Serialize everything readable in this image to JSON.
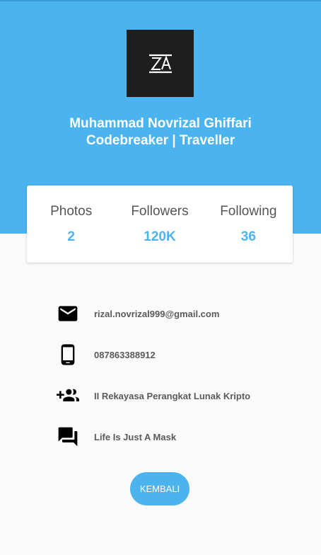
{
  "profile": {
    "name": "Muhammad Novrizal Ghiffari",
    "tagline": "Codebreaker | Traveller",
    "avatar_icon": "logo-za-icon"
  },
  "stats": [
    {
      "label": "Photos",
      "value": "2"
    },
    {
      "label": "Followers",
      "value": "120K"
    },
    {
      "label": "Following",
      "value": "36"
    }
  ],
  "info": [
    {
      "icon": "email-icon",
      "text": "rizal.novrizal999@gmail.com"
    },
    {
      "icon": "phone-icon",
      "text": "087863388912"
    },
    {
      "icon": "group-add-icon",
      "text": "II Rekayasa Perangkat Lunak Kripto"
    },
    {
      "icon": "chat-icon",
      "text": "Life Is Just A Mask"
    }
  ],
  "back_button": {
    "label": "KEMBALI"
  },
  "colors": {
    "accent": "#4bb3ee",
    "background": "#fafafa",
    "card": "#ffffff",
    "avatar_bg": "#1e1e1e"
  }
}
